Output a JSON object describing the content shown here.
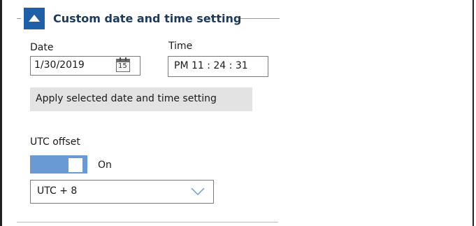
{
  "section": {
    "title": "Custom date and time setting",
    "expanded": true
  },
  "date": {
    "label": "Date",
    "value": "1/30/2019",
    "calendar_icon_text": "15"
  },
  "time": {
    "label": "Time",
    "value": "PM 11 : 24 : 31"
  },
  "apply_button": {
    "label": "Apply selected date and time setting"
  },
  "utc": {
    "label": "UTC offset",
    "toggle_state": "On",
    "toggle_on": true,
    "selected_offset": "UTC  + 8"
  },
  "colors": {
    "accent": "#1f5fa8",
    "toggle": "#6a9ad3",
    "title": "#1b3a5c",
    "button_bg": "#e3e3e3"
  }
}
